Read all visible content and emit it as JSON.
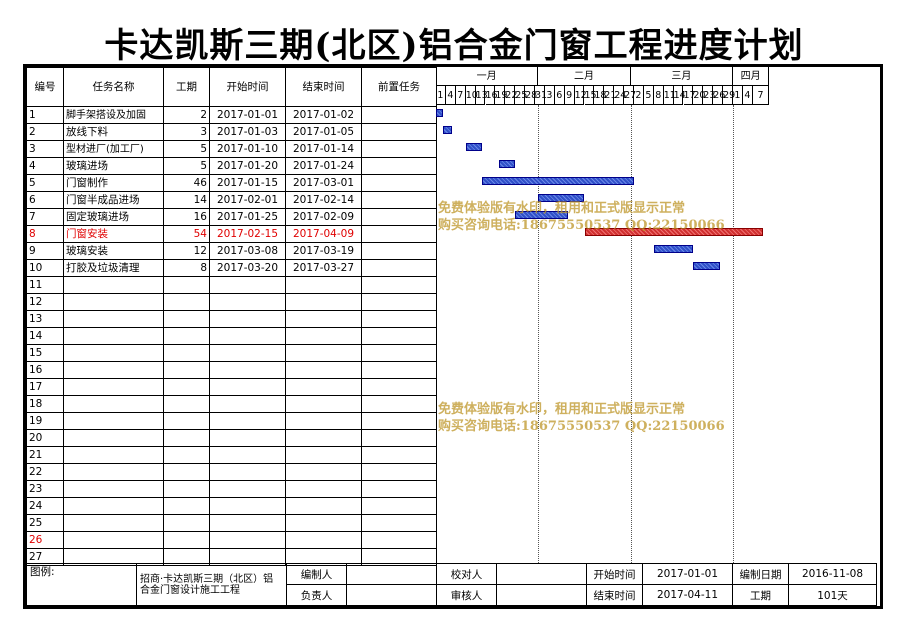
{
  "title": "卡达凯斯三期(北区)铝合金门窗工程进度计划",
  "headers": [
    "编号",
    "任务名称",
    "工期",
    "开始时间",
    "结束时间",
    "前置任务"
  ],
  "months": [
    "一月",
    "二月",
    "三月",
    "四月"
  ],
  "days": [
    "1",
    "4",
    "7",
    "10",
    "13",
    "16",
    "19",
    "22",
    "25",
    "28",
    "31",
    "3",
    "6",
    "9",
    "12",
    "15",
    "18",
    "21",
    "24",
    "27",
    "2",
    "5",
    "8",
    "11",
    "14",
    "17",
    "20",
    "23",
    "26",
    "29",
    "1",
    "4",
    "7"
  ],
  "tasks": [
    {
      "id": "1",
      "name": "脚手架搭设及加固",
      "dur": "2",
      "start": "2017-01-01",
      "end": "2017-01-02",
      "pred": "",
      "highlight": false
    },
    {
      "id": "2",
      "name": "放线下料",
      "dur": "3",
      "start": "2017-01-03",
      "end": "2017-01-05",
      "pred": "",
      "highlight": false
    },
    {
      "id": "3",
      "name": "型材进厂(加工厂)",
      "dur": "5",
      "start": "2017-01-10",
      "end": "2017-01-14",
      "pred": "",
      "highlight": false
    },
    {
      "id": "4",
      "name": "玻璃进场",
      "dur": "5",
      "start": "2017-01-20",
      "end": "2017-01-24",
      "pred": "",
      "highlight": false
    },
    {
      "id": "5",
      "name": "门窗制作",
      "dur": "46",
      "start": "2017-01-15",
      "end": "2017-03-01",
      "pred": "",
      "highlight": false
    },
    {
      "id": "6",
      "name": "门窗半成品进场",
      "dur": "14",
      "start": "2017-02-01",
      "end": "2017-02-14",
      "pred": "",
      "highlight": false
    },
    {
      "id": "7",
      "name": "固定玻璃进场",
      "dur": "16",
      "start": "2017-01-25",
      "end": "2017-02-09",
      "pred": "",
      "highlight": false
    },
    {
      "id": "8",
      "name": "门窗安装",
      "dur": "54",
      "start": "2017-02-15",
      "end": "2017-04-09",
      "pred": "",
      "highlight": true
    },
    {
      "id": "9",
      "name": "玻璃安装",
      "dur": "12",
      "start": "2017-03-08",
      "end": "2017-03-19",
      "pred": "",
      "highlight": false
    },
    {
      "id": "10",
      "name": "打胶及垃圾清理",
      "dur": "8",
      "start": "2017-03-20",
      "end": "2017-03-27",
      "pred": "",
      "highlight": false
    }
  ],
  "empty_rows": [
    "11",
    "12",
    "13",
    "14",
    "15",
    "16",
    "17",
    "18",
    "19",
    "20",
    "21",
    "22",
    "23",
    "24",
    "25",
    "26",
    "27"
  ],
  "red_rows": [
    "8",
    "26"
  ],
  "watermark": {
    "line1": "免费体验版有水印，租用和正式版显示正常",
    "line2": "购买咨询电话:18675550537 QQ:22150066"
  },
  "footer": {
    "legend_label": "图例:",
    "project": "招商·卡达凯斯三期（北区）铝合金门窗设计施工工程",
    "compiler_label": "编制人",
    "compiler": "",
    "proofreader_label": "校对人",
    "proofreader": "",
    "start_label": "开始时间",
    "start": "2017-01-01",
    "compile_date_label": "编制日期",
    "compile_date": "2016-11-08",
    "owner_label": "负责人",
    "owner": "",
    "reviewer_label": "审核人",
    "reviewer": "",
    "end_label": "结束时间",
    "end": "2017-04-11",
    "duration_label": "工期",
    "duration": "101天"
  },
  "colors": {
    "bar": "#3050c8",
    "critical_bar": "#d03030",
    "watermark": "#be9628"
  }
}
